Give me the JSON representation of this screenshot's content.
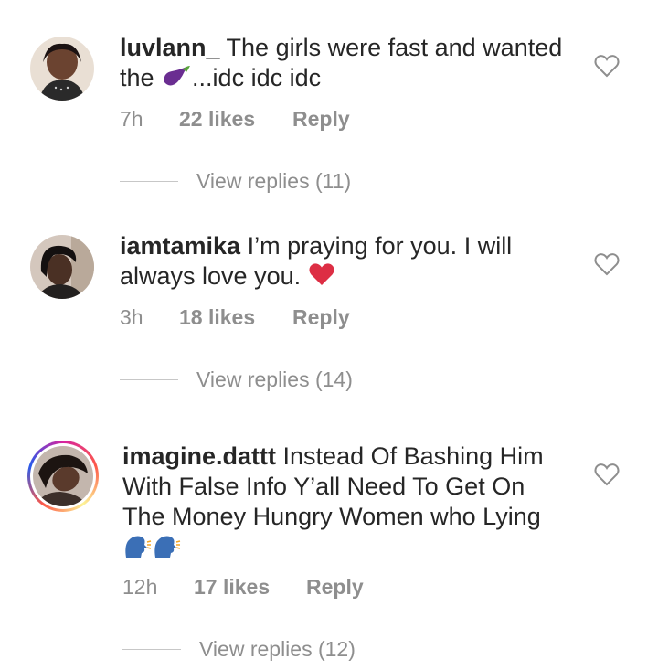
{
  "comments": [
    {
      "username": "luvlann_",
      "text_pre": "The girls were fast and wanted the ",
      "text_post": "...idc idc idc",
      "time": "7h",
      "likes": "22 likes",
      "reply_label": "Reply",
      "view_replies": "View replies (11)",
      "emoji": "eggplant-icon"
    },
    {
      "username": "iamtamika",
      "text_pre": "I’m praying for you. I will always love you.",
      "text_post": "",
      "time": "3h",
      "likes": "18 likes",
      "reply_label": "Reply",
      "view_replies": "View replies (14)",
      "emoji": "red-heart-icon"
    },
    {
      "username": "imagine.dattt",
      "text_pre": "Instead Of Bashing Him With False Info Y’all Need To Get On The Money Hungry Women who Lying",
      "text_post": "",
      "time": "12h",
      "likes": "17 likes",
      "reply_label": "Reply",
      "view_replies": "View replies (12)",
      "emoji": "speaking-head-icon"
    }
  ],
  "colors": {
    "text": "#262626",
    "meta": "#8e8e8e",
    "divider": "#c7c7c7"
  }
}
